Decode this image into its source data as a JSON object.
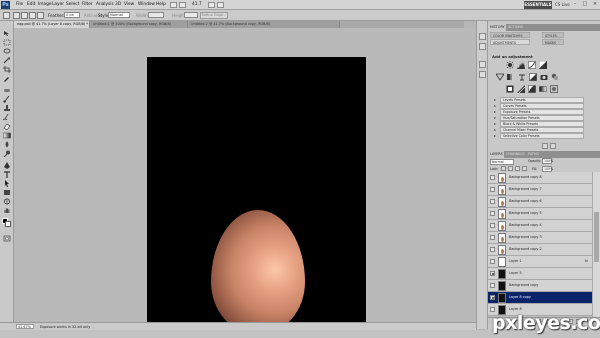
{
  "menubar": {
    "logo": "Ps",
    "items": [
      "File",
      "Edit",
      "Image",
      "Layer",
      "Select",
      "Filter",
      "Analysis",
      "3D",
      "View",
      "Window",
      "Help"
    ],
    "zoom_dropdown": "41.7",
    "workspace": "ESSENTIALS",
    "cs_live": "CS Live"
  },
  "options": {
    "feather_label": "Feather:",
    "feather_value": "0 px",
    "antialias_label": "Anti-alias",
    "style_label": "Style:",
    "style_value": "Normal",
    "width_label": "Width:",
    "height_label": "Height:",
    "refine_edge": "Refine Edge..."
  },
  "tabs": [
    {
      "label": "egg.psd @ 41.7% (Layer 8 copy, RGB/8) *",
      "active": true
    },
    {
      "label": "Untitled-1 @ 100% (Background copy, RGB/8)",
      "active": false
    },
    {
      "label": "Untitled-2 @ 41.7% (Background copy, RGB/8)",
      "active": false
    }
  ],
  "status": {
    "zoom": "41.67%",
    "text": "Exposure works in 32-bit only"
  },
  "right_panel": {
    "top_tabs": [
      "HISTORY",
      "ACTIONS"
    ],
    "mini_tabs": [
      "COLOR SWATCHES",
      "STYLES",
      "ADJUSTMENTS",
      "MASKS"
    ],
    "adjustments_title": "Add an adjustment",
    "presets": [
      "Levels Presets",
      "Curves Presets",
      "Exposure Presets",
      "Hue/Saturation Presets",
      "Black & White Presets",
      "Channel Mixer Presets",
      "Selective Color Presets"
    ]
  },
  "layers_panel": {
    "tabs": [
      "LAYERS",
      "CHANNELS",
      "PATHS"
    ],
    "blend_mode": "Normal",
    "opacity_label": "Opacity:",
    "opacity": "100%",
    "lock_label": "Lock:",
    "fill_label": "Fill:",
    "fill": "100%",
    "layers": [
      {
        "name": "Background copy 8",
        "thumb": "egg",
        "visible": false,
        "selected": false,
        "fx": ""
      },
      {
        "name": "Background copy 7",
        "thumb": "egg",
        "visible": false,
        "selected": false,
        "fx": ""
      },
      {
        "name": "Background copy 6",
        "thumb": "egg",
        "visible": false,
        "selected": false,
        "fx": ""
      },
      {
        "name": "Background copy 5",
        "thumb": "egg",
        "visible": false,
        "selected": false,
        "fx": ""
      },
      {
        "name": "Background copy 4",
        "thumb": "egg",
        "visible": false,
        "selected": false,
        "fx": ""
      },
      {
        "name": "Background copy 3",
        "thumb": "egg",
        "visible": false,
        "selected": false,
        "fx": ""
      },
      {
        "name": "Background copy 2",
        "thumb": "egg",
        "visible": false,
        "selected": false,
        "fx": ""
      },
      {
        "name": "Layer 1",
        "thumb": "white",
        "visible": false,
        "selected": false,
        "fx": "fx"
      },
      {
        "name": "Layer 5",
        "thumb": "dark",
        "visible": true,
        "selected": false,
        "fx": ""
      },
      {
        "name": "Background copy",
        "thumb": "dark",
        "visible": false,
        "selected": false,
        "fx": ""
      },
      {
        "name": "Layer 8 copy",
        "thumb": "dark",
        "visible": true,
        "selected": true,
        "fx": ""
      },
      {
        "name": "Layer 8",
        "thumb": "dark",
        "visible": false,
        "selected": false,
        "fx": ""
      }
    ]
  },
  "watermark": "pxleyes.com"
}
